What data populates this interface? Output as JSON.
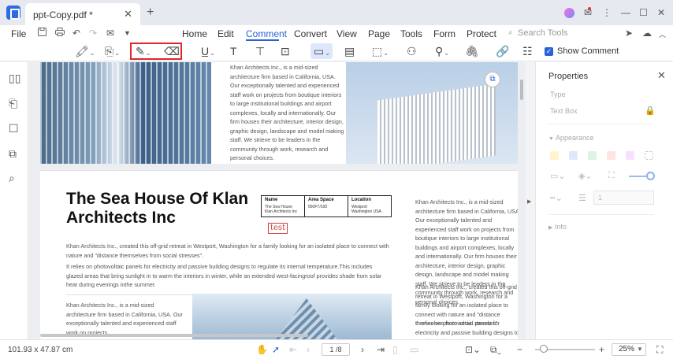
{
  "titlebar": {
    "tab_title": "ppt-Copy.pdf *",
    "tab_close": "✕",
    "tab_add": "+",
    "icon_minimize": "—",
    "icon_restore": "☐",
    "icon_close": "✕",
    "icon_menu": "⋮",
    "icon_notify": "✉"
  },
  "menubar": {
    "file": "File",
    "tabs": [
      "Home",
      "Edit",
      "Comment",
      "Convert",
      "View",
      "Page",
      "Tools",
      "Form",
      "Protect"
    ],
    "active_tab": "Comment",
    "search_placeholder": "Search Tools"
  },
  "toolbar": {
    "show_comment_label": "Show Comment",
    "checkmark": "✓"
  },
  "page1": {
    "paragraph": "Khan Architects Inc., is a mid-sized architecture firm based in California, USA. Our exceptionally talented and experienced staff work on projects from boutique interiors to large institutional buildings and airport complexes, locally and internationally. Our firm houses their architecture, interior design, graphic design, landscape and model making staff. We strieve to be leaders in the community through work, research and personal choices."
  },
  "page2": {
    "title": "The Sea House Of Klan Architects Inc",
    "table": {
      "headers": [
        "Name",
        "Area Space",
        "Location"
      ],
      "values": [
        "The Sea House Klan Architects Inc",
        "560FT/100",
        "Westport Washington USA"
      ]
    },
    "stamp": "test",
    "intro_1": "Khan Architects Inc., created this off-grid retreat in Westport, Washington for a family looking for an isolated place to connect with nature and \"distance themselves from social stresses\".",
    "intro_2": "It relies on photovoltaic panels for electricity and passive building designs to regulate its internal temperature.This includes glazed areas that bring sunlight in to warm the interiors in winter, while an extended west-facingroof provides shade from solar heat during evenings inthe summer.",
    "bottom_paragraph": "Khan Architects Inc., is a mid-sized architecture firm based in California, USA. Our exceptionally talented and experienced staff work on projects",
    "right_column_1": "Khan Architects Inc., is a mid-sized architecture firm based in California, USA. Our exceptionally talented and experienced staff work on projects from boutique interiors to large institutional buildings and airport complexes, locally and internationally. Our firm houses their architecture, interior design, graphic design, landscape and model making staff. We strieve to be leaders in the community through work, research and personal choices.",
    "right_column_2": "Khan Architects Inc., created this off-grid retreat in Westport, Washington for a family looking for an isolated place to connect with nature and \"distance themselves from social stresses\".",
    "right_column_3": "It relies on photovoltaic panels for electricity and passive building designs to regulate its internal temperature.This includes glazed areas that bring"
  },
  "properties": {
    "title": "Properties",
    "type_label": "Type",
    "type_value": "Text Box",
    "appearance_label": "Appearance",
    "info_label": "Info",
    "opacity_value": "1",
    "swatches": [
      "#fff4cc",
      "#dde8ff",
      "#ddf4e4",
      "#ffe4e0",
      "#f6e2ff"
    ]
  },
  "status": {
    "dimensions": "101.93 x 47.87 cm",
    "page_indicator": "1 /8",
    "zoom": "25%"
  }
}
